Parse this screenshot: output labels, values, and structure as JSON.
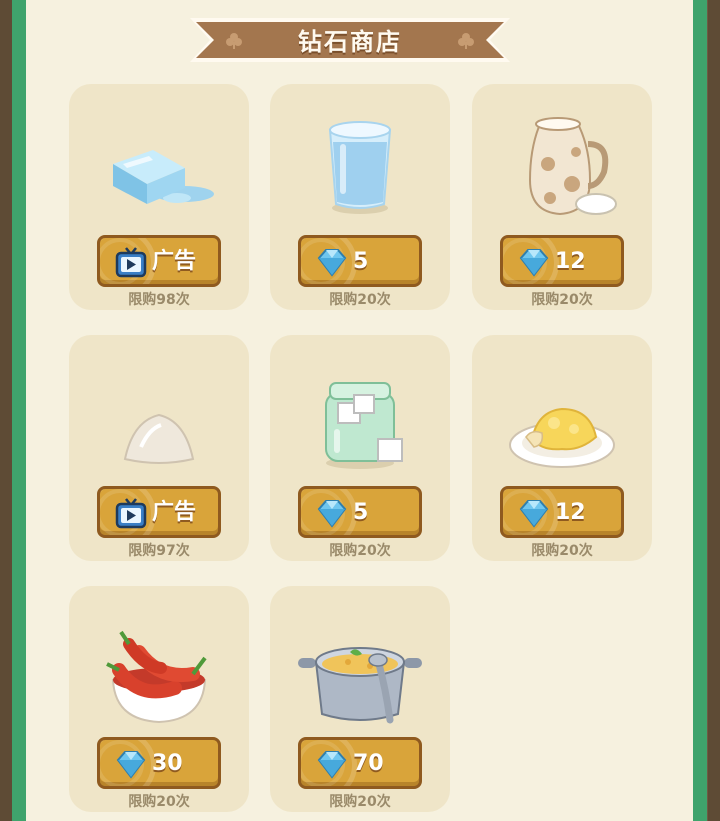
{
  "shop": {
    "title": "钻石商店"
  },
  "items": [
    {
      "name": "ice",
      "price_type": "ad",
      "price_label": "广告",
      "limit_text": "限购98次"
    },
    {
      "name": "water",
      "price_type": "diamond",
      "price_label": "5",
      "limit_text": "限购20次"
    },
    {
      "name": "milk",
      "price_type": "diamond",
      "price_label": "12",
      "limit_text": "限购20次"
    },
    {
      "name": "flour",
      "price_type": "ad",
      "price_label": "广告",
      "limit_text": "限购97次"
    },
    {
      "name": "sugar",
      "price_type": "diamond",
      "price_label": "5",
      "limit_text": "限购20次"
    },
    {
      "name": "scrambled-egg",
      "price_type": "diamond",
      "price_label": "12",
      "limit_text": "限购20次"
    },
    {
      "name": "chili-pepper",
      "price_type": "diamond",
      "price_label": "30",
      "limit_text": "限购20次"
    },
    {
      "name": "soup-pot",
      "price_type": "diamond",
      "price_label": "70",
      "limit_text": "限购20次"
    }
  ],
  "colors": {
    "frame_green": "#3fa36c",
    "panel_cream": "#f6f1df",
    "card_bg": "#efe5c8",
    "button_gold": "#d9a43a",
    "button_border": "#8f5a1f",
    "ribbon_brown": "#a3764e"
  }
}
